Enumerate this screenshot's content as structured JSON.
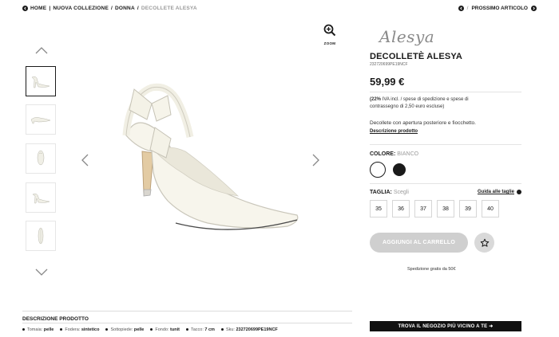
{
  "breadcrumb": {
    "items": [
      "HOME",
      "NUOVA COLLEZIONE",
      "DONNA",
      "DECOLLETE ALESYA"
    ],
    "separators": [
      "|",
      "/",
      "/"
    ]
  },
  "nav": {
    "separator": "/",
    "next_label": "PROSSIMO ARTICOLO"
  },
  "zoom": {
    "label": "ZOOM"
  },
  "product": {
    "brand_logo": "Alesya",
    "title": "DECOLLETÈ ALESYA",
    "sku_code": "232720699PE19NCF",
    "price": "59,99 €",
    "vat_bold": "(22%",
    "vat_rest": " IVA incl. / spese di spedizione e spese di contrassegno di 2,50 euro escluse)",
    "short_description": "Decollete con apertura posteriore e fiocchetto.",
    "description_link": "Descrizione prodotto"
  },
  "color": {
    "label": "COLORE:",
    "value": "BIANCO",
    "options": [
      "white",
      "black"
    ]
  },
  "size": {
    "label": "TAGLIA:",
    "placeholder": "Scegli",
    "guide_label": "Guida alle taglie",
    "options": [
      "35",
      "36",
      "37",
      "38",
      "39",
      "40"
    ]
  },
  "actions": {
    "add_to_cart": "AGGIUNGI AL CARRELLO",
    "shipping_note": "Spedizione gratis da 50€",
    "store_button": "TROVA IL NEGOZIO PIÙ VICINO A TE ➜"
  },
  "details": {
    "section_title": "DESCRIZIONE PRODOTTO",
    "specs": [
      {
        "key": "Tomaia:",
        "value": "pelle"
      },
      {
        "key": "Fodera:",
        "value": "sintetico"
      },
      {
        "key": "Sottopiede:",
        "value": "pelle"
      },
      {
        "key": "Fondo:",
        "value": "tunit"
      },
      {
        "key": "Tacco:",
        "value": "7 cm"
      },
      {
        "key": "Sku:",
        "value": "232720699PE19NCF"
      }
    ]
  },
  "colors": {
    "accent": "#1a1a1a",
    "disabled_button": "#cfcfcf",
    "store_button": "#111111"
  }
}
